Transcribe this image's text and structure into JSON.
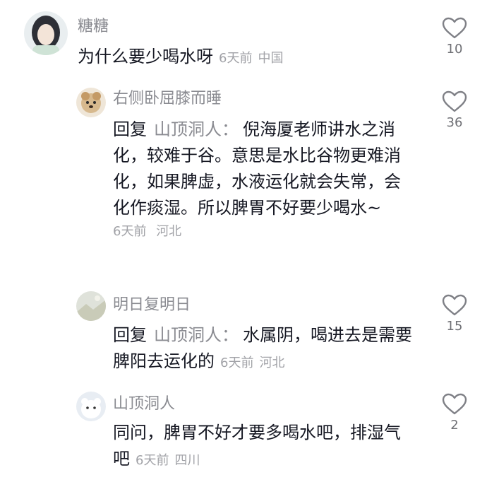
{
  "comments": [
    {
      "username": "糖糖",
      "text": "为什么要少喝水呀",
      "time": "6天前",
      "location": "中国",
      "likes": "10"
    },
    {
      "username": "右侧卧屈膝而睡",
      "reply_label": "回复",
      "reply_to": "山顶洞人：",
      "text": "倪海厦老师讲水之消化，较难于谷。意思是水比谷物更难消化，如果脾虚，水液运化就会失常，会化作痰湿。所以脾胃不好要少喝水~",
      "time": "6天前",
      "location": "河北",
      "likes": "36"
    },
    {
      "username": "明日复明日",
      "reply_label": "回复",
      "reply_to": "山顶洞人：",
      "text": "水属阴，喝进去是需要脾阳去运化的",
      "time": "6天前",
      "location": "河北",
      "likes": "15"
    },
    {
      "username": "山顶洞人",
      "text": "同问，脾胃不好才要多喝水吧，排湿气吧",
      "time": "6天前",
      "location": "四川",
      "likes": "2"
    }
  ],
  "colors": {
    "username": "#8a8b91",
    "text": "#161823",
    "meta": "#a1a2a7",
    "heart_stroke": "#7f8086"
  },
  "icons": [
    "heart-outline-icon"
  ]
}
